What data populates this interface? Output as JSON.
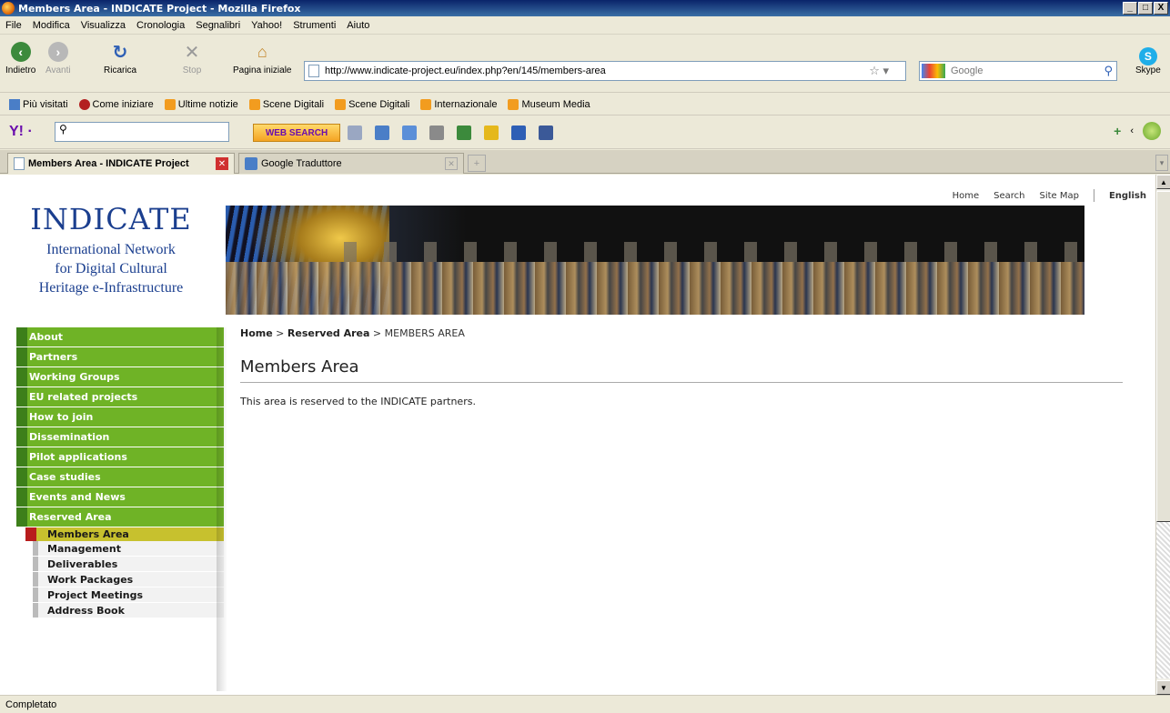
{
  "window": {
    "title": "Members Area - INDICATE Project - Mozilla Firefox",
    "min": "_",
    "max": "□",
    "close": "X"
  },
  "menu": [
    "File",
    "Modifica",
    "Visualizza",
    "Cronologia",
    "Segnalibri",
    "Yahoo!",
    "Strumenti",
    "Aiuto"
  ],
  "toolbar": {
    "back": "Indietro",
    "forward": "Avanti",
    "reload": "Ricarica",
    "stop": "Stop",
    "home": "Pagina iniziale",
    "url": "http://www.indicate-project.eu/index.php?en/145/members-area",
    "search_placeholder": "Google",
    "skype": "Skype"
  },
  "bookmarks": [
    "Più visitati",
    "Come iniziare",
    "Ultime notizie",
    "Scene Digitali",
    "Scene Digitali",
    "Internazionale",
    "Museum Media"
  ],
  "yahoo": {
    "web_search": "WEB SEARCH"
  },
  "tabs": [
    {
      "label": "Members Area - INDICATE Project",
      "active": true
    },
    {
      "label": "Google Traduttore",
      "active": false
    }
  ],
  "page": {
    "topnav": {
      "home": "Home",
      "search": "Search",
      "sitemap": "Site Map",
      "language": "English"
    },
    "logo": {
      "brand": "INDICATE",
      "line1": "International Network",
      "line2": "for Digital Cultural",
      "line3": "Heritage e-Infrastructure"
    },
    "sidebar": {
      "items": [
        "About",
        "Partners",
        "Working Groups",
        "EU related projects",
        "How to join",
        "Dissemination",
        "Pilot applications",
        "Case studies",
        "Events and News",
        "Reserved Area"
      ],
      "active": "Members Area",
      "subitems": [
        "Management",
        "Deliverables",
        "Work Packages",
        "Project Meetings",
        "Address Book"
      ]
    },
    "breadcrumb": {
      "home": "Home",
      "sep1": " > ",
      "reserved": "Reserved Area",
      "sep2": " > ",
      "current": "MEMBERS AREA"
    },
    "title": "Members Area",
    "body": "This area is reserved to the INDICATE partners."
  },
  "status": "Completato"
}
